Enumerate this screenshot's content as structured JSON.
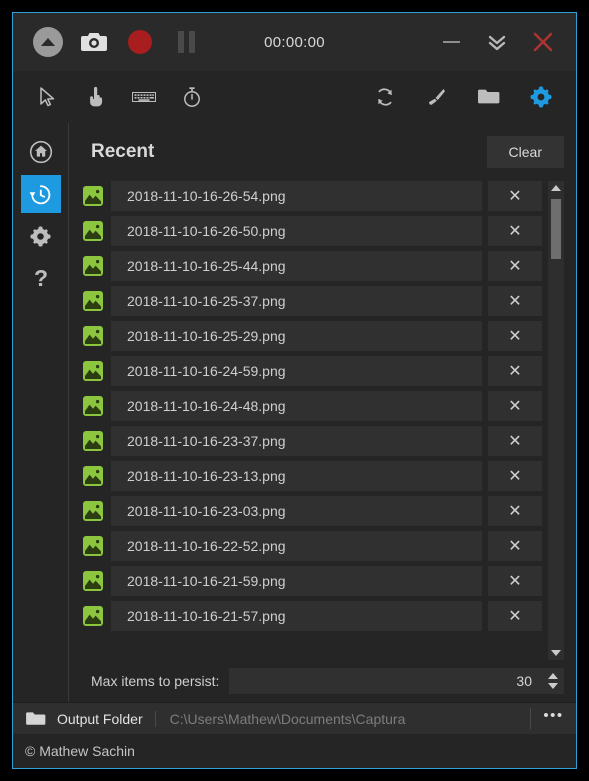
{
  "window": {
    "accent_color": "#2f9fd6",
    "background": "#252525"
  },
  "titlebar": {
    "timer": "00:00:00",
    "buttons": {
      "expand": "expand-collapse",
      "screenshot": "screenshot",
      "record": "record",
      "pause": "pause",
      "minimize": "minimize",
      "collapse": "collapse",
      "close": "close"
    }
  },
  "toolbar": {
    "left_icons": [
      "cursor-icon",
      "hand-icon",
      "keyboard-icon",
      "stopwatch-icon"
    ],
    "right_icons": [
      "refresh-icon",
      "brush-icon",
      "folder-icon",
      "gear-icon"
    ],
    "gear_color": "#1e9ae0"
  },
  "sidebar": {
    "items": [
      {
        "name": "home",
        "icon": "home-icon",
        "active": false
      },
      {
        "name": "recent",
        "icon": "history-icon",
        "active": true
      },
      {
        "name": "settings",
        "icon": "gear-icon",
        "active": false
      },
      {
        "name": "about",
        "icon": "question-icon",
        "active": false
      }
    ],
    "active_color": "#1e9ae0"
  },
  "recent": {
    "title": "Recent",
    "clear_label": "Clear",
    "delete_glyph": "✕",
    "items": [
      {
        "name": "2018-11-10-16-26-54.png"
      },
      {
        "name": "2018-11-10-16-26-50.png"
      },
      {
        "name": "2018-11-10-16-25-44.png"
      },
      {
        "name": "2018-11-10-16-25-37.png"
      },
      {
        "name": "2018-11-10-16-25-29.png"
      },
      {
        "name": "2018-11-10-16-24-59.png"
      },
      {
        "name": "2018-11-10-16-24-48.png"
      },
      {
        "name": "2018-11-10-16-23-37.png"
      },
      {
        "name": "2018-11-10-16-23-13.png"
      },
      {
        "name": "2018-11-10-16-23-03.png"
      },
      {
        "name": "2018-11-10-16-22-52.png"
      },
      {
        "name": "2018-11-10-16-21-59.png"
      },
      {
        "name": "2018-11-10-16-21-57.png"
      }
    ],
    "thumb_color": "#8cc63f"
  },
  "max_items": {
    "label": "Max items to persist:",
    "value": "30"
  },
  "output": {
    "label": "Output Folder",
    "path": "C:\\Users\\Mathew\\Documents\\Captura",
    "more_glyph": "•••"
  },
  "footer": {
    "copyright": "© Mathew Sachin"
  }
}
